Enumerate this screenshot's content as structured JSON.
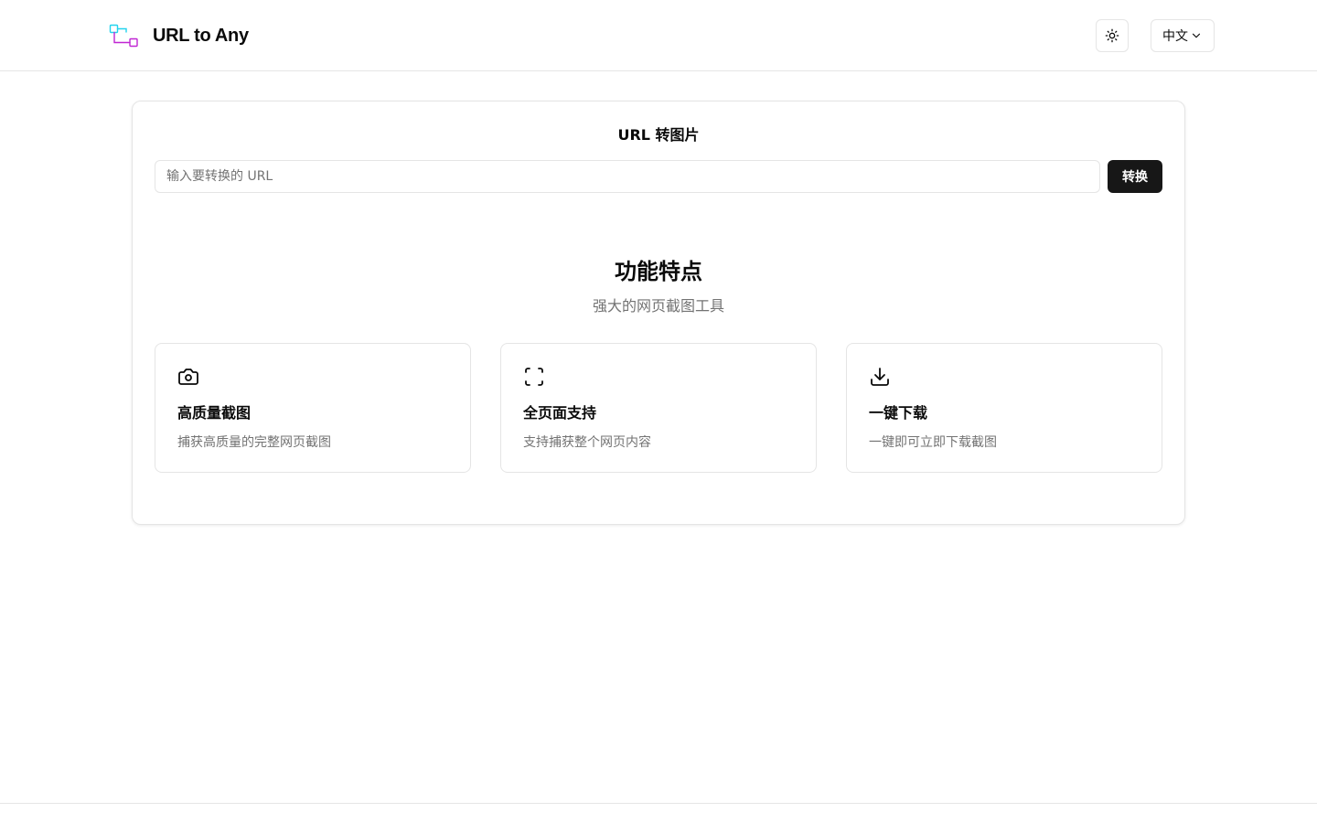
{
  "header": {
    "brand_title": "URL to Any",
    "language_label": "中文",
    "icons": {
      "logo": "url-logo-icon",
      "theme": "sun-icon",
      "language": "chevron-down-icon"
    }
  },
  "converter": {
    "title": "URL 转图片",
    "input_placeholder": "输入要转换的 URL",
    "input_value": "",
    "button_label": "转换"
  },
  "features": {
    "title": "功能特点",
    "subtitle": "强大的网页截图工具",
    "items": [
      {
        "icon": "camera-icon",
        "title": "高质量截图",
        "description": "捕获高质量的完整网页截图"
      },
      {
        "icon": "fullscreen-icon",
        "title": "全页面支持",
        "description": "支持捕获整个网页内容"
      },
      {
        "icon": "download-icon",
        "title": "一键下载",
        "description": "一键即可立即下载截图"
      }
    ]
  },
  "colors": {
    "primary_button": "#171717",
    "border": "#e5e5e5",
    "muted_text": "#737373",
    "logo_cyan": "#22d3ee",
    "logo_purple": "#c026d3"
  }
}
